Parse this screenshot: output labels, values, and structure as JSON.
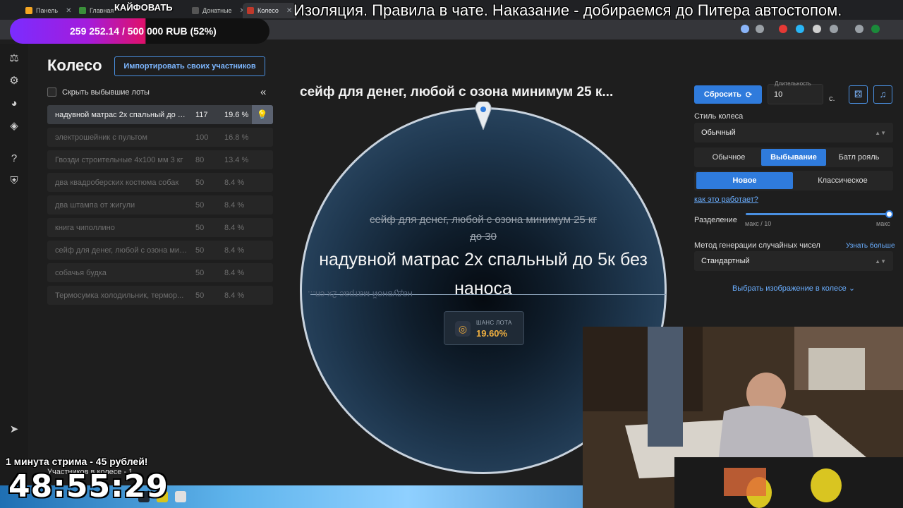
{
  "browser": {
    "tabs": [
      {
        "label": "Панель",
        "color": "#f5a623"
      },
      {
        "label": "Главная",
        "color": "#3a8f3a"
      },
      {
        "label": "Донатные",
        "color": "#555555"
      },
      {
        "label": "Колесо",
        "color": "#c0392b"
      }
    ]
  },
  "overlay": {
    "donate_title": "КАЙФОВАТЬ",
    "donate_goal": "259 252.14 / 500 000 RUB (52%)",
    "donate_progress": 0.52,
    "ticker": "Изоляция. Правила в чате. Наказание - добираемся до Питера автостопом.",
    "promo": "1 минута стрима - 45 рублей!",
    "timer": "48:55:29"
  },
  "sidebar": {
    "icons": [
      "gavel-icon",
      "gear-icon",
      "wheel-icon",
      "layers-icon",
      "help-icon",
      "shield-icon",
      "telegram-icon"
    ]
  },
  "left_panel": {
    "title": "Колесо",
    "import_button": "Импортировать своих участников",
    "hide_lots_label": "Скрыть выбывшие лоты",
    "collapse_glyph": "«",
    "participants": "Участников в колесе - 1",
    "lots": [
      {
        "name": "надувной матрас 2х спальный до 5к без наноса",
        "amount": "117",
        "percent": "19.6 %",
        "state": "current"
      },
      {
        "name": "электрошейник с пультом",
        "amount": "100",
        "percent": "16.8 %",
        "state": "out"
      },
      {
        "name": "Гвозди строительные 4х100 мм 3 кг",
        "amount": "80",
        "percent": "13.4 %",
        "state": "out"
      },
      {
        "name": "два квадроберских костюма собак",
        "amount": "50",
        "percent": "8.4 %",
        "state": "out"
      },
      {
        "name": "два штампа от жигули",
        "amount": "50",
        "percent": "8.4 %",
        "state": "out"
      },
      {
        "name": "книга чиполлино",
        "amount": "50",
        "percent": "8.4 %",
        "state": "out"
      },
      {
        "name": "сейф для денег, любой с озона минимум 25 кг до 30",
        "amount": "50",
        "percent": "8.4 %",
        "state": "out"
      },
      {
        "name": "собачья будка",
        "amount": "50",
        "percent": "8.4 %",
        "state": "out"
      },
      {
        "name": "Термосумка холодильник, термор...",
        "amount": "50",
        "percent": "8.4 %",
        "state": "out"
      }
    ]
  },
  "wheel": {
    "title": "сейф для денег, любой с озона минимум 25 к...",
    "prev_winner": "сейф для денег, любой с озона минимум 25 кг до 30",
    "winner": "надувной матрас 2х спальный до 5к без наноса",
    "mirror_text": "надувной матрас 2х сп...",
    "chance_label": "ШАНС ЛОТА",
    "chance_value": "19.60%"
  },
  "settings": {
    "reset_button": "Сбросить",
    "duration_label": "Длительность",
    "duration_value": "10",
    "seconds_unit": "с.",
    "wheel_style_label": "Стиль колеса",
    "wheel_style_value": "Обычный",
    "mode_options": [
      "Обычное",
      "Выбывание",
      "Батл рояль"
    ],
    "mode_selected": "Выбывание",
    "variant_options": [
      "Новое",
      "Классическое"
    ],
    "variant_selected": "Новое",
    "how_link": "как это работает?",
    "split_label": "Разделение",
    "split_min": "макс / 10",
    "split_max": "макс",
    "split_value": 1.0,
    "rng_label": "Метод генерации случайных чисел",
    "rng_learn_more": "Узнать больше",
    "rng_value": "Стандартный",
    "pick_image": "Выбрать изображение в колесе"
  },
  "colors": {
    "accent": "#2f7bdc",
    "chance": "#f0b040",
    "link": "#6aaeff"
  }
}
